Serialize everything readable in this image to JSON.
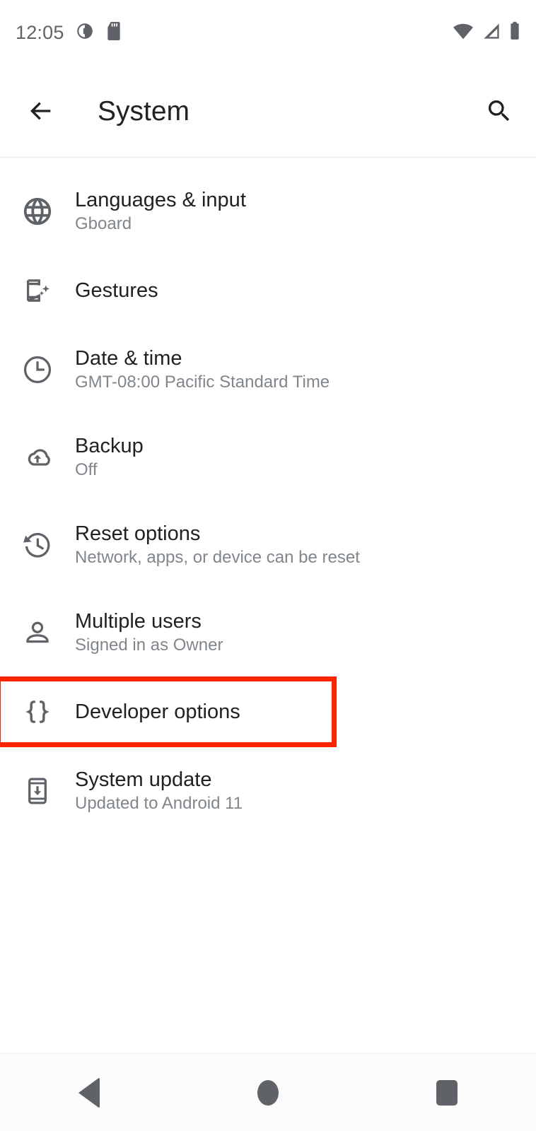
{
  "status_bar": {
    "time": "12:05",
    "left_icons": [
      {
        "name": "contrast-circle-icon"
      },
      {
        "name": "sd-card-icon"
      }
    ],
    "right_icons": [
      {
        "name": "wifi-icon"
      },
      {
        "name": "cellular-signal-icon"
      },
      {
        "name": "battery-full-icon"
      }
    ]
  },
  "app_bar": {
    "back_icon": "back-arrow-icon",
    "title": "System",
    "search_icon": "search-icon"
  },
  "colors": {
    "highlight": "#ff2400",
    "title_text": "#202124",
    "subtitle_text": "#80868b",
    "icon": "#5f6368",
    "background": "#ffffff",
    "nav_background": "#fbfbfb"
  },
  "settings": {
    "items": [
      {
        "icon": "globe-icon",
        "title": "Languages & input",
        "subtitle": "Gboard",
        "highlighted": false
      },
      {
        "icon": "gestures-phone-sparkle-icon",
        "title": "Gestures",
        "subtitle": "",
        "highlighted": false
      },
      {
        "icon": "clock-icon",
        "title": "Date & time",
        "subtitle": "GMT-08:00 Pacific Standard Time",
        "highlighted": false
      },
      {
        "icon": "cloud-upload-icon",
        "title": "Backup",
        "subtitle": "Off",
        "highlighted": false
      },
      {
        "icon": "history-restore-icon",
        "title": "Reset options",
        "subtitle": "Network, apps, or device can be reset",
        "highlighted": false
      },
      {
        "icon": "person-icon",
        "title": "Multiple users",
        "subtitle": "Signed in as Owner",
        "highlighted": false
      },
      {
        "icon": "curly-braces-icon",
        "title": "Developer options",
        "subtitle": "",
        "highlighted": true
      },
      {
        "icon": "system-update-phone-icon",
        "title": "System update",
        "subtitle": "Updated to Android 11",
        "highlighted": false
      }
    ]
  },
  "nav_bar": {
    "back_label": "Back",
    "home_label": "Home",
    "recents_label": "Recents"
  }
}
